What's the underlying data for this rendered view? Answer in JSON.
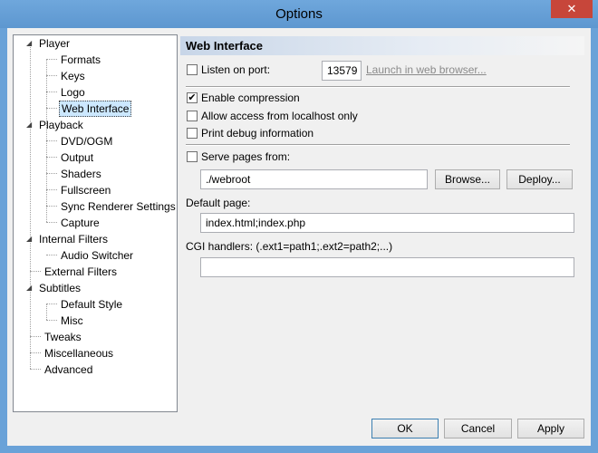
{
  "window": {
    "title": "Options",
    "close_glyph": "✕"
  },
  "tree": {
    "items": [
      {
        "label": "Player",
        "toggle": "◢"
      },
      {
        "label": "Formats"
      },
      {
        "label": "Keys"
      },
      {
        "label": "Logo"
      },
      {
        "label": "Web Interface"
      },
      {
        "label": "Playback",
        "toggle": "◢"
      },
      {
        "label": "DVD/OGM"
      },
      {
        "label": "Output"
      },
      {
        "label": "Shaders"
      },
      {
        "label": "Fullscreen"
      },
      {
        "label": "Sync Renderer Settings"
      },
      {
        "label": "Capture"
      },
      {
        "label": "Internal Filters",
        "toggle": "◢"
      },
      {
        "label": "Audio Switcher"
      },
      {
        "label": "External Filters"
      },
      {
        "label": "Subtitles",
        "toggle": "◢"
      },
      {
        "label": "Default Style"
      },
      {
        "label": "Misc"
      },
      {
        "label": "Tweaks"
      },
      {
        "label": "Miscellaneous"
      },
      {
        "label": "Advanced"
      }
    ],
    "selected": "Web Interface"
  },
  "panel": {
    "header": "Web Interface",
    "listen_label": "Listen on port:",
    "listen_checked": false,
    "port_value": "13579",
    "launch_link": "Launch in web browser...",
    "compression_label": "Enable compression",
    "compression_checked": true,
    "compression_mark": "✔",
    "localhost_label": "Allow access from localhost only",
    "localhost_checked": false,
    "debug_label": "Print debug information",
    "debug_checked": false,
    "serve_label": "Serve pages from:",
    "serve_checked": false,
    "webroot_value": "./webroot",
    "browse_label": "Browse...",
    "deploy_label": "Deploy...",
    "default_page_label": "Default page:",
    "default_page_value": "index.html;index.php",
    "cgi_label": "CGI handlers: (.ext1=path1;.ext2=path2;...)",
    "cgi_value": ""
  },
  "buttons": {
    "ok": "OK",
    "cancel": "Cancel",
    "apply": "Apply"
  }
}
